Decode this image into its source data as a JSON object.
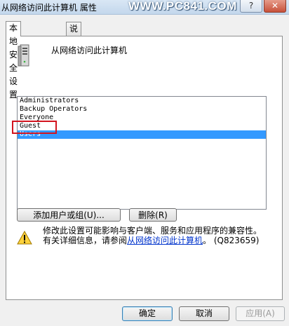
{
  "window": {
    "title": "从网络访问此计算机 属性",
    "watermark": "WWW.PC841.COM",
    "controls": [
      "?",
      "✕"
    ]
  },
  "tabs": [
    {
      "label": "本地安全设置",
      "active": true
    },
    {
      "label": "说明",
      "active": false
    }
  ],
  "policy": {
    "name": "从网络访问此计算机",
    "icon": "computer-tower-icon"
  },
  "principals": [
    {
      "label": "Administrators",
      "selected": false
    },
    {
      "label": "Backup Operators",
      "selected": false
    },
    {
      "label": "Everyone",
      "selected": false
    },
    {
      "label": "Guest",
      "selected": false,
      "highlighted": true
    },
    {
      "label": "Users",
      "selected": true
    }
  ],
  "actions": {
    "add_label": "添加用户或组(U)...",
    "remove_label": "删除(R)"
  },
  "warning": {
    "icon": "warning-icon",
    "line1": "修改此设置可能影响与客户端、服务和应用程序的兼容性。",
    "line2_prefix": "有关详细信息，请参阅",
    "link_text": "从网络访问此计算机",
    "line2_suffix": "。 (Q823659)"
  },
  "footer": {
    "ok_label": "确定",
    "cancel_label": "取消",
    "apply_label": "应用(A)"
  },
  "colors": {
    "selection": "#3399ff",
    "highlight_box": "#d2141e",
    "link": "#0033cc"
  }
}
